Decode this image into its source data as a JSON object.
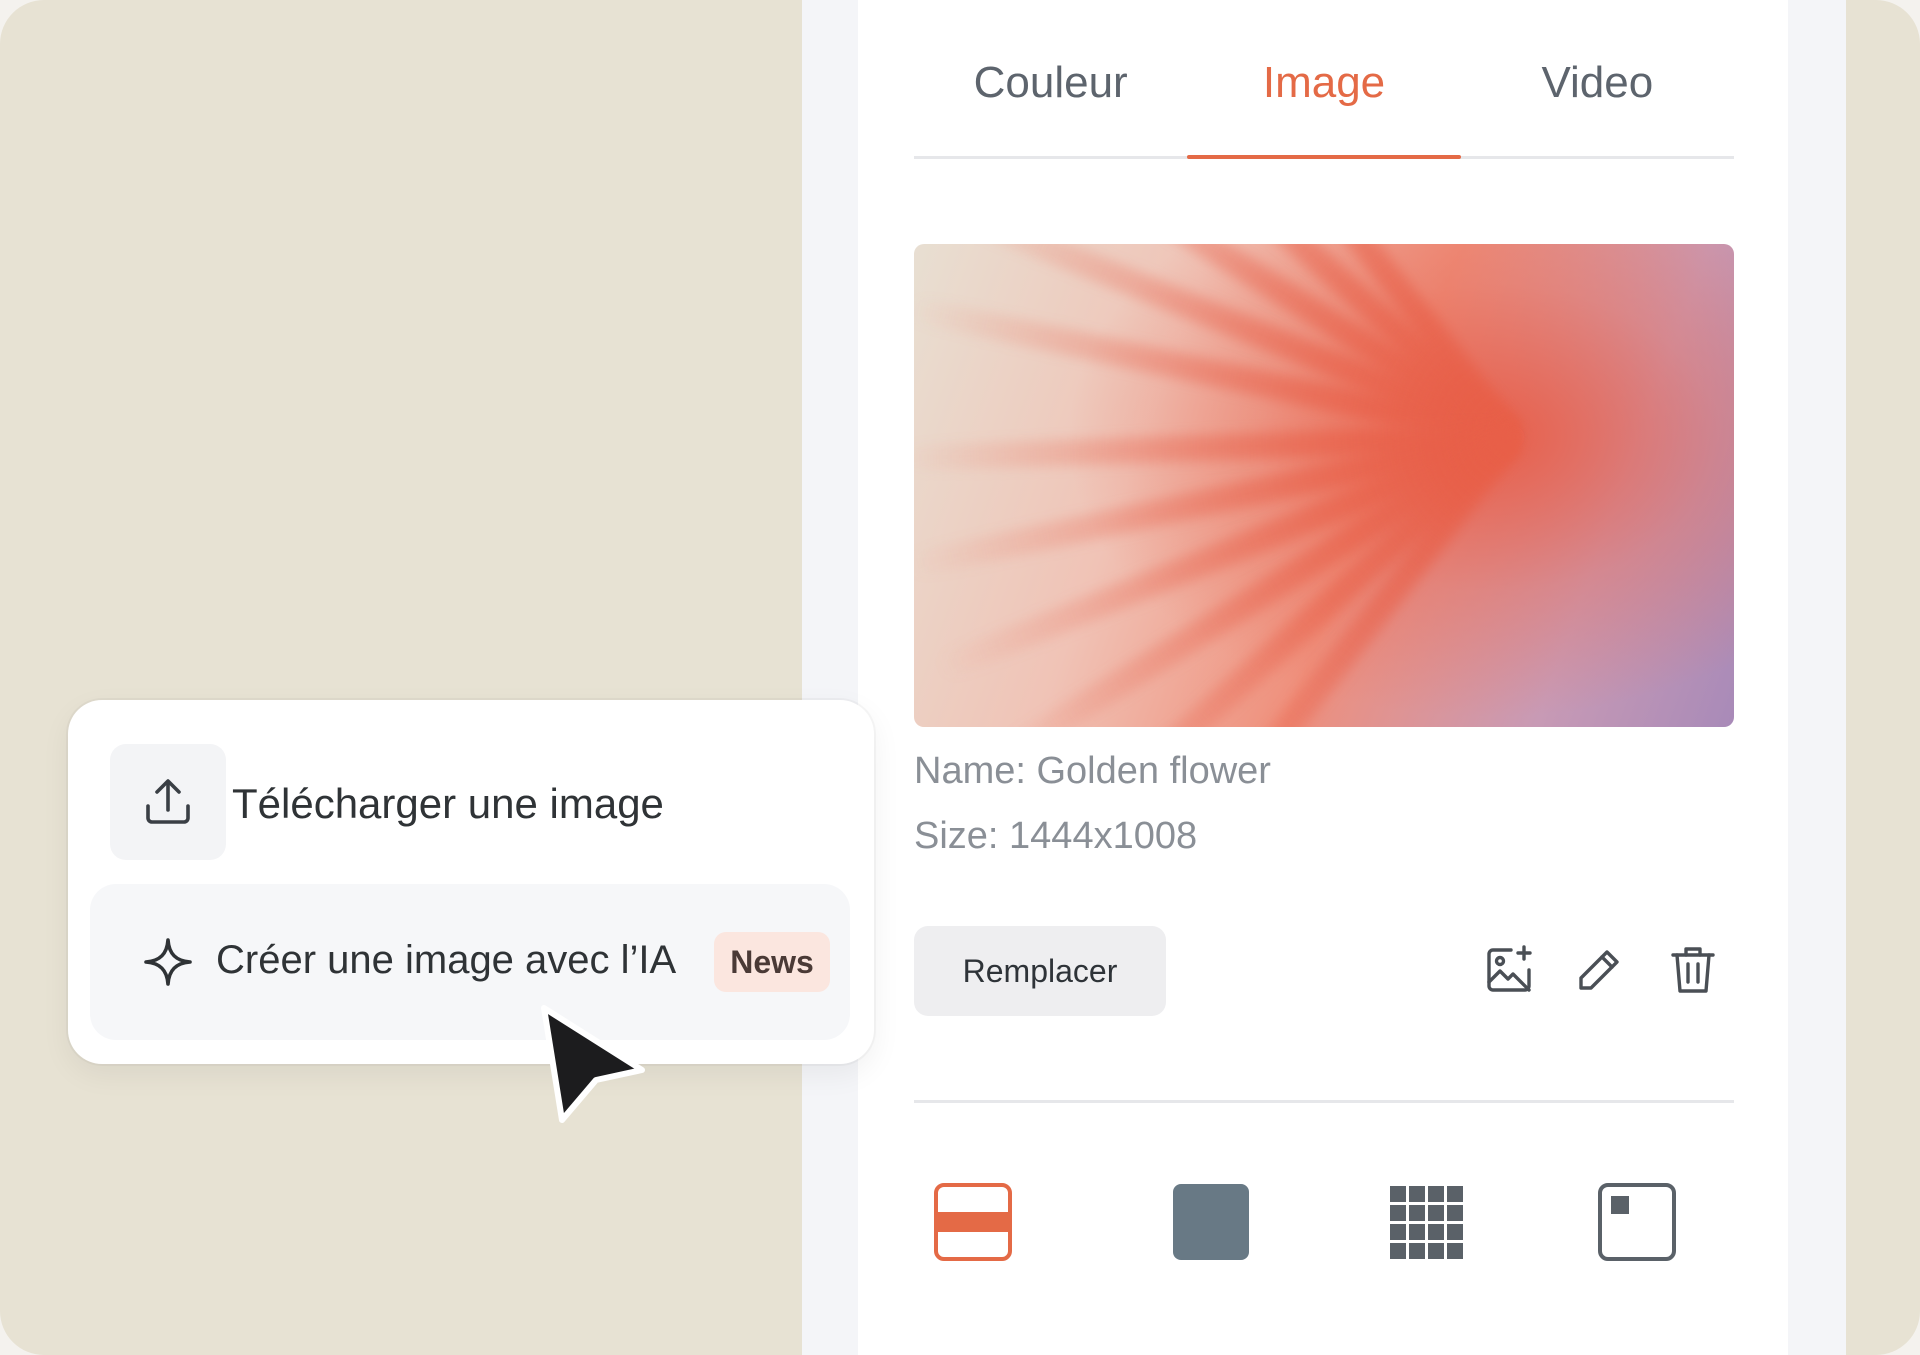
{
  "tabs": [
    {
      "label": "Couleur",
      "active": false
    },
    {
      "label": "Image",
      "active": true
    },
    {
      "label": "Video",
      "active": false
    }
  ],
  "image_info": {
    "name": "Name: Golden flower",
    "size": "Size: 1444x1008"
  },
  "actions": {
    "replace_label": "Remplacer",
    "icons": [
      "ai-image-icon",
      "pencil-icon",
      "trash-icon"
    ]
  },
  "layout_options": [
    "layout-band-icon",
    "layout-fill-icon",
    "layout-grid-icon",
    "layout-corner-icon"
  ],
  "menu": {
    "upload_label": "Télécharger une image",
    "ai_label": "Créer une image avec l’IA",
    "ai_badge": "News"
  },
  "colors": {
    "accent": "#e46a46",
    "background": "#e7e2d3",
    "badge_bg": "#fbe6df",
    "swatch_gray": "#687985"
  }
}
